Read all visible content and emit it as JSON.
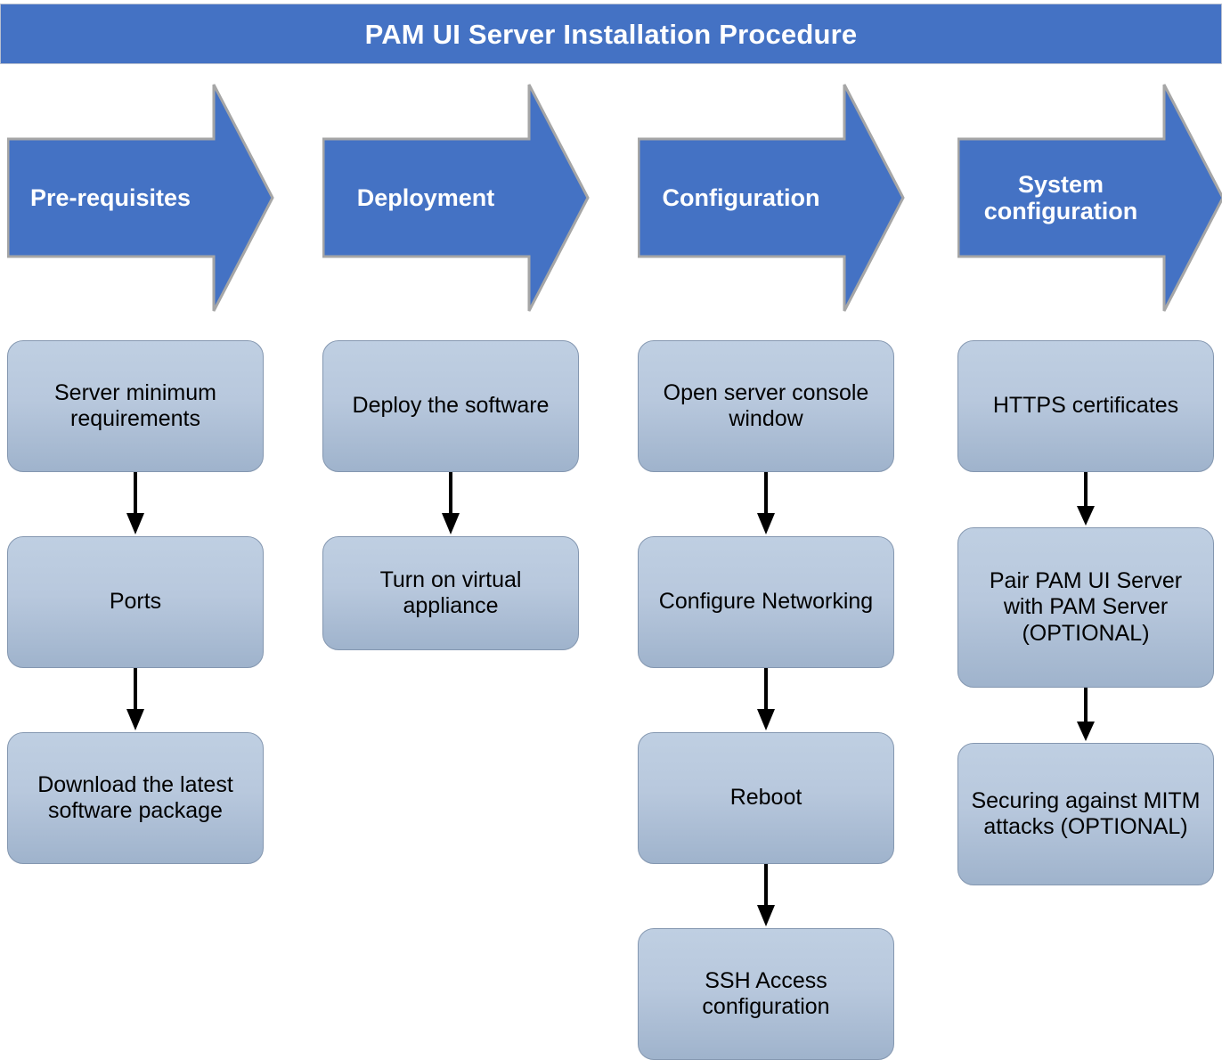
{
  "header": {
    "title": "PAM UI Server Installation Procedure",
    "background_color": "#4472c4",
    "text_color": "#ffffff"
  },
  "theme": {
    "arrow_fill": "#4472c4",
    "arrow_border": "#a6a6a6",
    "box_border": "#8497b0",
    "box_gradient_top": "#bfcfe2",
    "box_gradient_bottom": "#9fb3cc",
    "connector_color": "#000000",
    "box_text_color": "#000000"
  },
  "phases": [
    {
      "id": "pre-requisites",
      "label": "Pre-requisites"
    },
    {
      "id": "deployment",
      "label": "Deployment"
    },
    {
      "id": "configuration",
      "label": "Configuration"
    },
    {
      "id": "system-configuration",
      "label": "System configuration"
    }
  ],
  "columns": [
    {
      "phase": "Pre-requisites",
      "steps": [
        {
          "label": "Server minimum requirements"
        },
        {
          "label": "Ports"
        },
        {
          "label": "Download the latest software package"
        }
      ]
    },
    {
      "phase": "Deployment",
      "steps": [
        {
          "label": "Deploy the software"
        },
        {
          "label": "Turn on virtual appliance"
        }
      ]
    },
    {
      "phase": "Configuration",
      "steps": [
        {
          "label": "Open server console window"
        },
        {
          "label": "Configure Networking"
        },
        {
          "label": "Reboot"
        },
        {
          "label": "SSH Access configuration"
        }
      ]
    },
    {
      "phase": "System configuration",
      "steps": [
        {
          "label": "HTTPS certificates"
        },
        {
          "label": "Pair PAM UI Server with PAM Server (OPTIONAL)"
        },
        {
          "label": "Securing against MITM attacks (OPTIONAL)"
        }
      ]
    }
  ]
}
